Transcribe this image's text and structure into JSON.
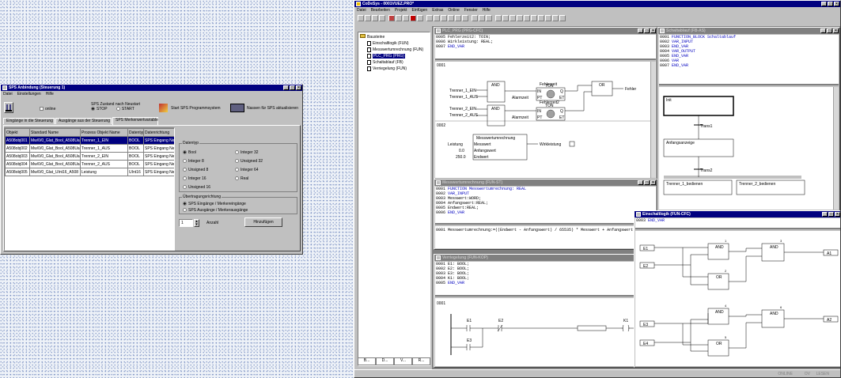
{
  "sps": {
    "title": "SPS Anbindung (Steuerung 1)",
    "menu": [
      "Datei",
      "Einstellungen",
      "Hilfe"
    ],
    "online_label": "online",
    "state_label": "SPS Zustand nach Neustart",
    "stop_label": "STOP",
    "start_label": "START",
    "start_btn": "Start SPS Programmsystem",
    "refresh_btn": "Nassen für SPS aktualisieren",
    "tabs": [
      "Eingänge in die Steuerung",
      "Ausgänge aus der Steuerung",
      "SPS Merkerwertvariable"
    ],
    "headers": [
      "Objekt",
      "Standard Name",
      "Prozess Objekt Name",
      "Datentyp",
      "Datenrichtung"
    ],
    "rows": [
      [
        "A508obj001",
        "Mw/0/0_Glat_Bool_A508Ual",
        "Trenner_1_EIN",
        "BOOL",
        "SPS Eingang Ne"
      ],
      [
        "A508obj002",
        "Mw/0/0_Glat_Bool_A508Ual",
        "Trenner_1_AUS",
        "BOOL",
        "SPS Eingang Ne"
      ],
      [
        "A508obj003",
        "Mw/0/0_Glat_Bool_A508Ual",
        "Trenner_2_EIN",
        "BOOL",
        "SPS Eingang Ne"
      ],
      [
        "A508obj004",
        "Mw/0/0_Glat_Bool_A508Ual",
        "Trenner_2_AUS",
        "BOOL",
        "SPS Eingang Ne"
      ],
      [
        "A508obj005",
        "Mw/0/0_Glat_UInt16_A508",
        "Leistung",
        "UInt16",
        "SPS Eingang Ne"
      ]
    ],
    "datatype_label": "Datentyp",
    "types": [
      [
        "Bool",
        "Integer 32"
      ],
      [
        "Integer 8",
        "Unsigned 32"
      ],
      [
        "Unsigned 8",
        "Integer 64"
      ],
      [
        "Integer 16",
        "Real"
      ],
      [
        "Unsigned 16",
        ""
      ]
    ],
    "direction_label": "Übertragungsrichtung",
    "directions": [
      "SPS Eingänge / Merkereingänge",
      "SPS Ausgänge / Merkerausgänge"
    ],
    "count_value": "1",
    "count_label": "Anzahl",
    "add_btn": "Hinzufügen"
  },
  "codesys": {
    "title": "CoDeSys - 0001VUEZ.PRO*",
    "menu": [
      "Datei",
      "Bearbeiten",
      "Projekt",
      "Einfügen",
      "Extras",
      "Online",
      "Fenster",
      "Hilfe"
    ],
    "tree_root": "Bausteine",
    "tree_items": [
      "Einschaltlogik (FUN)",
      "Messwertumrechnung (FUN)",
      "PLC_PRG (PRG)",
      "Schaltablauf (FB)",
      "Verriegelung (FUN)"
    ],
    "tree_tabs": [
      "B...",
      "D...",
      "V...",
      "R..."
    ],
    "status": [
      "ONLINE",
      "OV",
      "LESEN"
    ],
    "plcprg": {
      "title": "PLC_PRG (PRG-CFC)",
      "decl": [
        {
          "n": "0005",
          "t": "Fehlerzeit2: TOIN;"
        },
        {
          "n": "0006",
          "t": "Wirkleistung: REAL;"
        },
        {
          "n": "0007",
          "t": "END_VAR"
        }
      ],
      "net1": "0001",
      "net2": "0002",
      "fehlerzeit": "Fehlerzeit",
      "fehlerzeit2": "Fehlerzeit2",
      "t1_ein": "Trenner_1_EIN",
      "t1_aus": "Trenner_1_AUS",
      "t2_ein": "Trenner_2_EIN",
      "t2_aus": "Trenner_2_AUS",
      "and": "AND",
      "or": "OR",
      "ton": "TON",
      "in": "IN",
      "q": "Q",
      "pt": "PT",
      "et": "ET",
      "alarm": "Alarmzeit",
      "fehler": "Fehler",
      "mess": "Messwertumrechnung",
      "messwert": "Messwert",
      "anfang": "Anfangswert",
      "endwert": "Endwert",
      "leistung": "Leistung",
      "v00": "0.0",
      "v250": "250.0",
      "wirk": "Wirkleistung"
    },
    "schalt": {
      "title": "Schaltablauf (FB-AS)",
      "decl": [
        {
          "n": "0001",
          "t": "FUNCTION_BLOCK Schaltablauf"
        },
        {
          "n": "0002",
          "t": "VAR_INPUT"
        },
        {
          "n": "0003",
          "t": "END_VAR"
        },
        {
          "n": "0004",
          "t": "VAR_OUTPUT"
        },
        {
          "n": "0005",
          "t": "END_VAR"
        },
        {
          "n": "0006",
          "t": "VAR"
        },
        {
          "n": "0007",
          "t": "END_VAR"
        }
      ],
      "init": "Init",
      "trans1": "Trans1",
      "step2": "Anfangsanzeige",
      "trans2": "Trans2",
      "step3a": "Trenner_1_bedienen",
      "step3b": "Trenner_2_bedienen"
    },
    "messw": {
      "title": "Messwertumrechnung (FUN-ST)",
      "decl": [
        {
          "n": "0001",
          "t": "FUNCTION Messwertumrechnung: REAL"
        },
        {
          "n": "0002",
          "t": "VAR_INPUT"
        },
        {
          "n": "0003",
          "t": "  Messwert:WORD;"
        },
        {
          "n": "0004",
          "t": "  Anfangswert:REAL;"
        },
        {
          "n": "0005",
          "t": "  Endwert:REAL;"
        },
        {
          "n": "0006",
          "t": "END_VAR"
        }
      ],
      "body_n": "0001",
      "body": "Messwertumrechnung:=((Endwert - Anfangswert) / 65535) * Messwert + Anfangswert;"
    },
    "verr": {
      "title": "Verriegelung (FUN-KOP)",
      "decl": [
        {
          "n": "0001",
          "t": "E1: BOOL;"
        },
        {
          "n": "0002",
          "t": "E2: BOOL;"
        },
        {
          "n": "0003",
          "t": "E3: BOOL;"
        },
        {
          "n": "0004",
          "t": "K1: BOOL;"
        },
        {
          "n": "0005",
          "t": "END_VAR"
        }
      ],
      "net": "0001",
      "e1": "E1",
      "e2": "E2",
      "e3": "E3",
      "k1": "K1"
    },
    "ein": {
      "title": "Einschaltlogik (FUN-CFC)",
      "decl": [
        {
          "n": "0003",
          "t": "END_VAR"
        }
      ],
      "inputs": [
        "E1",
        "E2",
        "E3",
        "E4"
      ],
      "outputs": [
        "A1",
        "A2"
      ],
      "and": "AND",
      "or": "OR",
      "nums": [
        "1",
        "2",
        "3",
        "4",
        "5",
        "6",
        "7",
        "8",
        "9"
      ]
    }
  }
}
